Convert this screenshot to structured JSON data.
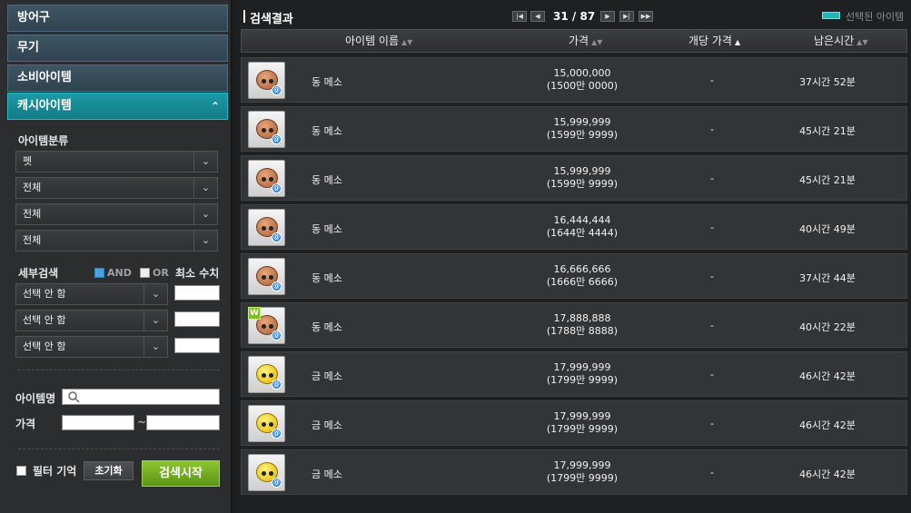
{
  "categories": [
    {
      "label": "방어구"
    },
    {
      "label": "무기"
    },
    {
      "label": "소비아이템"
    },
    {
      "label": "캐시아이템",
      "chevron": "⌃"
    }
  ],
  "filters": {
    "category_label": "아이템분류",
    "selects": [
      "펫",
      "전체",
      "전체",
      "전체"
    ],
    "detail_label": "세부검색",
    "and_label": "AND",
    "or_label": "OR",
    "min_label": "최소 수치",
    "detail_selects": [
      "선택 안 함",
      "선택 안 함",
      "선택 안 함"
    ],
    "item_name_label": "아이템명",
    "price_label": "가격",
    "price_sep": "~",
    "remember_label": "필터 기억",
    "reset_label": "초기화",
    "search_label": "검색시작"
  },
  "results": {
    "title": "검색결과",
    "page_current": "31",
    "page_sep": "/",
    "page_total": "87",
    "legend": "선택된 아이템",
    "legend_color": "#23b5b3",
    "columns": {
      "name": "아이템 이름",
      "price": "가격",
      "unit_price": "개당 가격",
      "remaining": "남은시간"
    },
    "rows": [
      {
        "name": "동 메소",
        "price": "15,000,000",
        "price_kr": "(1500만 0000)",
        "unit": "-",
        "time": "37시간 52분",
        "coin": "bronze",
        "badge": ""
      },
      {
        "name": "동 메소",
        "price": "15,999,999",
        "price_kr": "(1599만 9999)",
        "unit": "-",
        "time": "45시간 21분",
        "coin": "bronze",
        "badge": ""
      },
      {
        "name": "동 메소",
        "price": "15,999,999",
        "price_kr": "(1599만 9999)",
        "unit": "-",
        "time": "45시간 21분",
        "coin": "bronze",
        "badge": ""
      },
      {
        "name": "동 메소",
        "price": "16,444,444",
        "price_kr": "(1644만 4444)",
        "unit": "-",
        "time": "40시간 49분",
        "coin": "bronze",
        "badge": ""
      },
      {
        "name": "동 메소",
        "price": "16,666,666",
        "price_kr": "(1666만 6666)",
        "unit": "-",
        "time": "37시간 44분",
        "coin": "bronze",
        "badge": ""
      },
      {
        "name": "동 메소",
        "price": "17,888,888",
        "price_kr": "(1788만 8888)",
        "unit": "-",
        "time": "40시간 22분",
        "coin": "bronze",
        "badge": "W"
      },
      {
        "name": "금 메소",
        "price": "17,999,999",
        "price_kr": "(1799만 9999)",
        "unit": "-",
        "time": "46시간 42분",
        "coin": "gold",
        "badge": ""
      },
      {
        "name": "금 메소",
        "price": "17,999,999",
        "price_kr": "(1799만 9999)",
        "unit": "-",
        "time": "46시간 42분",
        "coin": "gold",
        "badge": ""
      },
      {
        "name": "금 메소",
        "price": "17,999,999",
        "price_kr": "(1799만 9999)",
        "unit": "-",
        "time": "46시간 42분",
        "coin": "gold",
        "badge": ""
      }
    ]
  }
}
